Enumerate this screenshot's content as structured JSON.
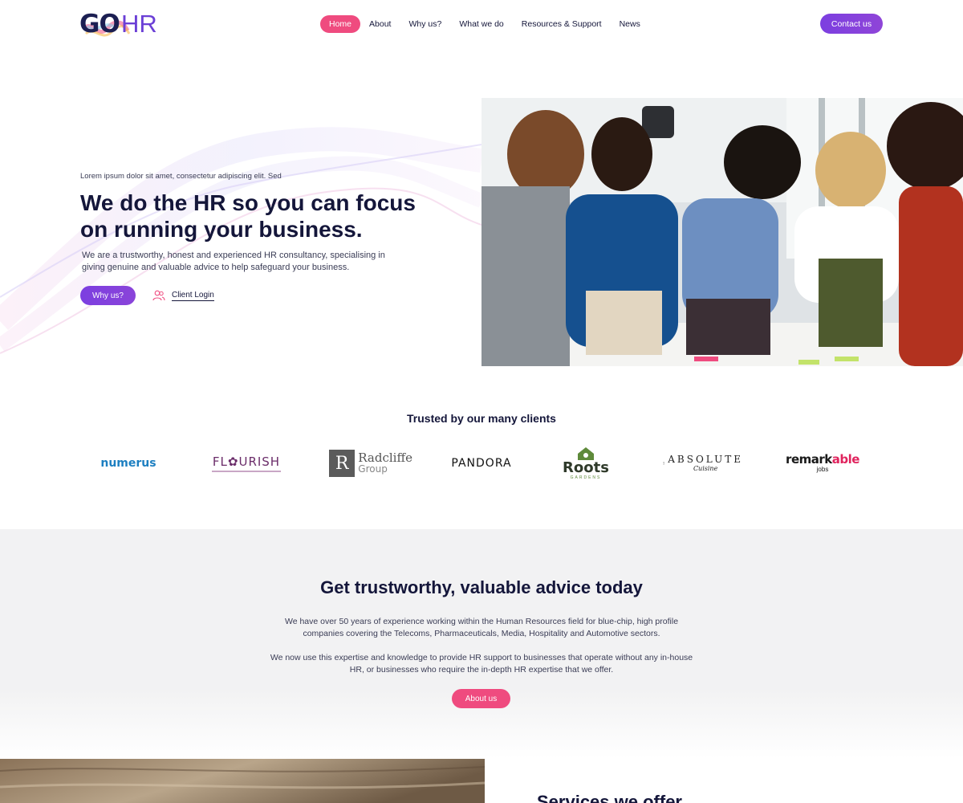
{
  "brand": {
    "logo_go": "GO",
    "logo_hr": "HR"
  },
  "nav": {
    "items": [
      {
        "label": "Home",
        "active": true
      },
      {
        "label": "About"
      },
      {
        "label": "Why us?"
      },
      {
        "label": "What we do"
      },
      {
        "label": "Resources & Support"
      },
      {
        "label": "News"
      }
    ],
    "contact_label": "Contact us"
  },
  "hero": {
    "kicker": "Lorem ipsum dolor sit amet, consectetur adipiscing elit. Sed",
    "title": "We do the HR so you can focus on running your business.",
    "text": "We are a trustworthy, honest and experienced HR consultancy, specialising in giving genuine and valuable advice to help safeguard your business.",
    "why_label": "Why us?",
    "login_label": "Client Login"
  },
  "clients": {
    "heading": "Trusted by our many clients",
    "logos": {
      "numerus": "numerus",
      "flourish": "FL✿URISH",
      "radcliffe_letter": "R",
      "radcliffe_name": "Radcliffe",
      "radcliffe_sub": "Group",
      "pandora": "PANDORA",
      "roots": "Roots",
      "roots_sub": "GARDENS",
      "absolute": "ABSOLUTE",
      "absolute_sub": "Cuisine",
      "remark_1": "remark",
      "remark_2": "able",
      "remark_sub": "jobs"
    }
  },
  "advice": {
    "title": "Get trustworthy, valuable advice today",
    "p1": "We have over 50 years of experience working within the Human Resources field for blue-chip, high profile companies covering the Telecoms, Pharmaceuticals, Media, Hospitality and Automotive sectors.",
    "p2": "We now use this expertise and knowledge to provide HR support to businesses that operate without any in-house HR, or businesses who require the in-depth HR expertise that we offer.",
    "about_label": "About us"
  },
  "services": {
    "title": "Services we offer"
  },
  "colors": {
    "accent_pink": "#ef4b7f",
    "accent_purple": "#7c3fe0",
    "navy": "#14163a"
  }
}
